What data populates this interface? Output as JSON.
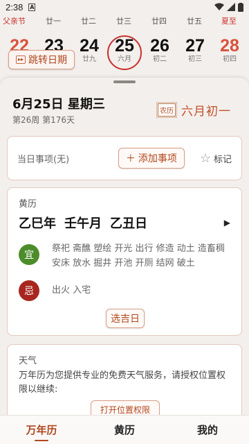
{
  "status_bar": {
    "time": "2:38",
    "notification_icon": "A"
  },
  "calendar_strip": {
    "holidays": [
      {
        "label": "父亲节",
        "color": "#c8302c"
      },
      {
        "label": "廿一",
        "color": "#555555"
      },
      {
        "label": "廿二",
        "color": "#555555"
      },
      {
        "label": "廿三",
        "color": "#555555"
      },
      {
        "label": "廿四",
        "color": "#555555"
      },
      {
        "label": "廿五",
        "color": "#555555"
      },
      {
        "label": "夏至",
        "color": "#c8302c"
      }
    ],
    "days": [
      {
        "num": "22",
        "lunar": "",
        "color": "#d8533d"
      },
      {
        "num": "23",
        "lunar": "",
        "color": "#111111"
      },
      {
        "num": "24",
        "lunar": "廿九",
        "color": "#111111"
      },
      {
        "num": "25",
        "lunar": "六月",
        "color": "#111111"
      },
      {
        "num": "26",
        "lunar": "初二",
        "color": "#111111"
      },
      {
        "num": "27",
        "lunar": "初三",
        "color": "#111111"
      },
      {
        "num": "28",
        "lunar": "初四",
        "color": "#d8533d"
      }
    ],
    "jump_button": "跳转日期"
  },
  "day_header": {
    "date": "6月25日 星期三",
    "week_info": "第26周 第176天",
    "lunar_tag": "农历",
    "lunar_date": "六月初一"
  },
  "events": {
    "label": "当日事项(无)",
    "add_button": "添加事项",
    "mark_button": "标记"
  },
  "almanac": {
    "section_title": "黄历",
    "year": "乙巳年",
    "month": "壬午月",
    "day": "乙丑日",
    "yi_label": "宜",
    "yi_items": "祭祀 斋醮 塑绘 开光 出行 修造 动土 造畜稠 安床 放水 掘井 开池 开厕 结网 破土",
    "ji_label": "忌",
    "ji_items": "出火 入宅",
    "pick_button": "选吉日"
  },
  "weather": {
    "section_title": "天气",
    "message": "万年历为您提供专业的免费天气服务，请授权位置权限以继续:",
    "permission_button": "打开位置权限"
  },
  "bottom_nav": {
    "items": [
      "万年历",
      "黄历",
      "我的"
    ],
    "active": "万年历"
  },
  "colors": {
    "accent": "#b0481f",
    "selected_ring": "#c8302c",
    "yi": "#4c8c2b",
    "ji": "#a8261f"
  }
}
